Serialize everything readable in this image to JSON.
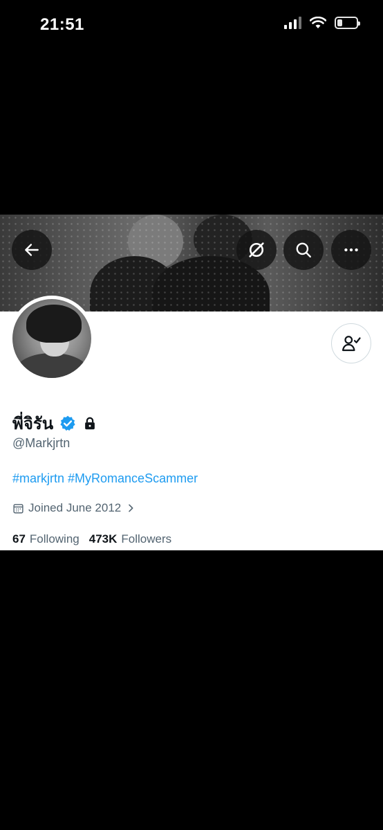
{
  "status_bar": {
    "time": "21:51",
    "battery_level": 0.2
  },
  "header": {
    "back_icon": "arrow-left-icon",
    "grok_icon": "grok-icon",
    "search_icon": "search-icon",
    "more_icon": "more-horizontal-icon"
  },
  "profile": {
    "display_name": "พี่จิรัน",
    "verified_icon": "verified-badge-icon",
    "protected_icon": "lock-icon",
    "handle": "@Markjrtn",
    "bio_hashtags": [
      "#markjrtn",
      "#MyRomanceScammer"
    ],
    "joined": "Joined June 2012",
    "following_count": "67",
    "following_label": "Following",
    "followers_count": "473K",
    "followers_label": "Followers",
    "follow_button_icon": "follow-request-icon"
  },
  "colors": {
    "accent": "#1d9bf0",
    "text_primary": "#0f1419",
    "text_secondary": "#536471",
    "background": "#ffffff",
    "screen": "#000000"
  }
}
